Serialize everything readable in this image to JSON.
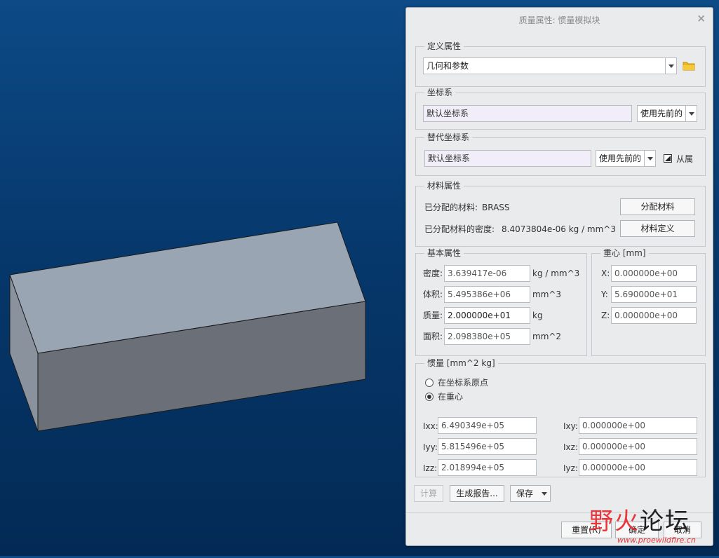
{
  "dialog": {
    "title": "质量属性: 惯量模拟块",
    "close_glyph": "×"
  },
  "define": {
    "legend": "定义属性",
    "value": "几何和参数",
    "folder_icon": "folder-icon"
  },
  "coord": {
    "legend": "坐标系",
    "value": "默认坐标系",
    "mode": "使用先前的"
  },
  "alt_coord": {
    "legend": "替代坐标系",
    "value": "默认坐标系",
    "mode": "使用先前的",
    "from_label": "从属"
  },
  "material": {
    "legend": "材料属性",
    "assigned_label": "已分配的材料:",
    "assigned_value": "BRASS",
    "density_label": "已分配材料的密度:",
    "density_value": "8.4073804e-06  kg / mm^3",
    "assign_button": "分配材料",
    "define_button": "材料定义"
  },
  "basic": {
    "legend": "基本属性",
    "rows": [
      {
        "label": "密度:",
        "value": "3.639417e-06",
        "unit": "kg / mm^3"
      },
      {
        "label": "体积:",
        "value": "5.495386e+06",
        "unit": "mm^3"
      },
      {
        "label": "质量:",
        "value": "2.000000e+01",
        "unit": "kg"
      },
      {
        "label": "面积:",
        "value": "2.098380e+05",
        "unit": "mm^2"
      }
    ]
  },
  "cog": {
    "legend": "重心 [mm]",
    "rows": [
      {
        "label": "X:",
        "value": "0.000000e+00"
      },
      {
        "label": "Y:",
        "value": "5.690000e+01"
      },
      {
        "label": "Z:",
        "value": "0.000000e+00"
      }
    ]
  },
  "inertia": {
    "legend": "惯量 [mm^2 kg]",
    "radio_origin": "在坐标系原点",
    "radio_cog": "在重心",
    "selected": "cog",
    "ixx_label": "Ixx:",
    "ixx": "6.490349e+05",
    "iyy_label": "Iyy:",
    "iyy": "5.815496e+05",
    "izz_label": "Izz:",
    "izz": "2.018994e+05",
    "ixy_label": "Ixy:",
    "ixy": "0.000000e+00",
    "ixz_label": "Ixz:",
    "ixz": "0.000000e+00",
    "iyz_label": "Iyz:",
    "iyz": "0.000000e+00"
  },
  "actions": {
    "compute": "计算",
    "report": "生成报告...",
    "save": "保存"
  },
  "footer": {
    "reset": "重置(R)",
    "ok": "确定",
    "cancel": "取消"
  },
  "watermark": {
    "text_a": "野",
    "text_b": "火",
    "text_c": "论坛",
    "url": "www.proewildfire.cn"
  },
  "colors": {
    "background_top": "#0d4a86",
    "background_bottom": "#032a55",
    "block_top": "#9aa5b4",
    "block_front": "#6b7078",
    "block_left": "#8a929d",
    "dialog_bg": "#eaebec",
    "field_lavender": "#f1eefa",
    "watermark_red": "#e8363a"
  }
}
